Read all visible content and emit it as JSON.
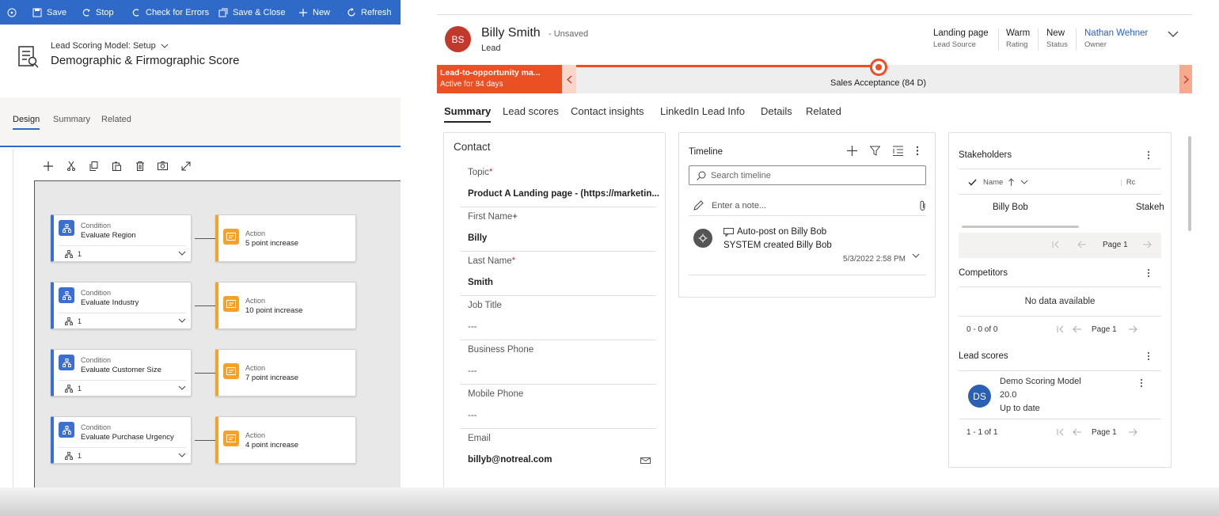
{
  "designer": {
    "toolbar": {
      "save": "Save",
      "stop": "Stop",
      "check_errors": "Check for Errors",
      "save_close": "Save & Close",
      "new": "New",
      "refresh": "Refresh"
    },
    "subtitle": "Lead Scoring Model: Setup",
    "title": "Demographic & Firmographic Score",
    "tabs": [
      "Design",
      "Summary",
      "Related"
    ],
    "rows": [
      {
        "condition_kind": "Condition",
        "condition_name": "Evaluate Region",
        "branch_count": "1",
        "action_kind": "Action",
        "action_name": "5 point increase"
      },
      {
        "condition_kind": "Condition",
        "condition_name": "Evaluate Industry",
        "branch_count": "1",
        "action_kind": "Action",
        "action_name": "10 point increase"
      },
      {
        "condition_kind": "Condition",
        "condition_name": "Evaluate Customer Size",
        "branch_count": "1",
        "action_kind": "Action",
        "action_name": "7 point increase"
      },
      {
        "condition_kind": "Condition",
        "condition_name": "Evaluate Purchase Urgency",
        "branch_count": "1",
        "action_kind": "Action",
        "action_name": "4 point increase"
      }
    ]
  },
  "record": {
    "initials": "BS",
    "name": "Billy Smith",
    "unsaved": "- Unsaved",
    "entity": "Lead",
    "header_fields": [
      {
        "value": "Landing page",
        "label": "Lead Source"
      },
      {
        "value": "Warm",
        "label": "Rating"
      },
      {
        "value": "New",
        "label": "Status"
      },
      {
        "value": "Nathan Wehner",
        "label": "Owner"
      }
    ],
    "process": {
      "stage_title": "Lead-to-opportunity ma...",
      "stage_active": "Active for 84 days",
      "current_stage": "Sales Acceptance  (84 D)"
    },
    "tabs": [
      "Summary",
      "Lead scores",
      "Contact insights",
      "LinkedIn Lead Info",
      "Details",
      "Related"
    ],
    "contact": {
      "title": "Contact",
      "fields": [
        {
          "label": "Topic",
          "required": "*",
          "value": "Product A Landing page - (https://marketin..."
        },
        {
          "label": "First Name",
          "required": "+",
          "value": "Billy"
        },
        {
          "label": "Last Name",
          "required": "*",
          "value": "Smith"
        },
        {
          "label": "Job Title",
          "required": "",
          "value": "---"
        },
        {
          "label": "Business Phone",
          "required": "",
          "value": "---"
        },
        {
          "label": "Mobile Phone",
          "required": "",
          "value": "---"
        },
        {
          "label": "Email",
          "required": "",
          "value": "billyb@notreal.com"
        }
      ]
    },
    "timeline": {
      "title": "Timeline",
      "search_placeholder": "Search timeline",
      "note_placeholder": "Enter a note...",
      "post_title": "Auto-post on Billy Bob",
      "post_sub": "SYSTEM created Billy Bob",
      "post_date": "5/3/2022 2:58 PM"
    },
    "stakeholders": {
      "title": "Stakeholders",
      "col_name": "Name",
      "col_role": "Rc",
      "row_name": "Billy Bob",
      "row_role": "Stakeh",
      "page": "Page 1"
    },
    "competitors": {
      "title": "Competitors",
      "empty": "No data available",
      "count": "0 - 0 of 0",
      "page": "Page 1"
    },
    "lead_scores": {
      "title": "Lead scores",
      "initials": "DS",
      "model": "Demo Scoring Model",
      "score": "20.0",
      "status": "Up to date",
      "count": "1 - 1 of 1",
      "page": "Page 1"
    }
  },
  "colors": {
    "command_bar": "#2f6ac8",
    "process_accent": "#eb5024",
    "condition": "#3b6fd1",
    "action": "#f7a226",
    "owner_link": "#2b62c4"
  },
  "icons": [
    "info-icon",
    "save-icon",
    "stop-icon",
    "check-icon",
    "save-close-icon",
    "plus-icon",
    "refresh-icon",
    "model-icon",
    "chevron-down-icon",
    "cut-icon",
    "copy-icon",
    "paste-icon",
    "delete-icon",
    "snapshot-icon",
    "expand-icon",
    "branch-icon",
    "score-icon",
    "filter-icon",
    "list-icon",
    "more-icon",
    "search-icon",
    "pencil-icon",
    "paperclip-icon",
    "post-icon",
    "email-icon",
    "check-mark-icon",
    "sort-up-icon",
    "first-page-icon",
    "prev-page-icon",
    "next-page-icon"
  ]
}
